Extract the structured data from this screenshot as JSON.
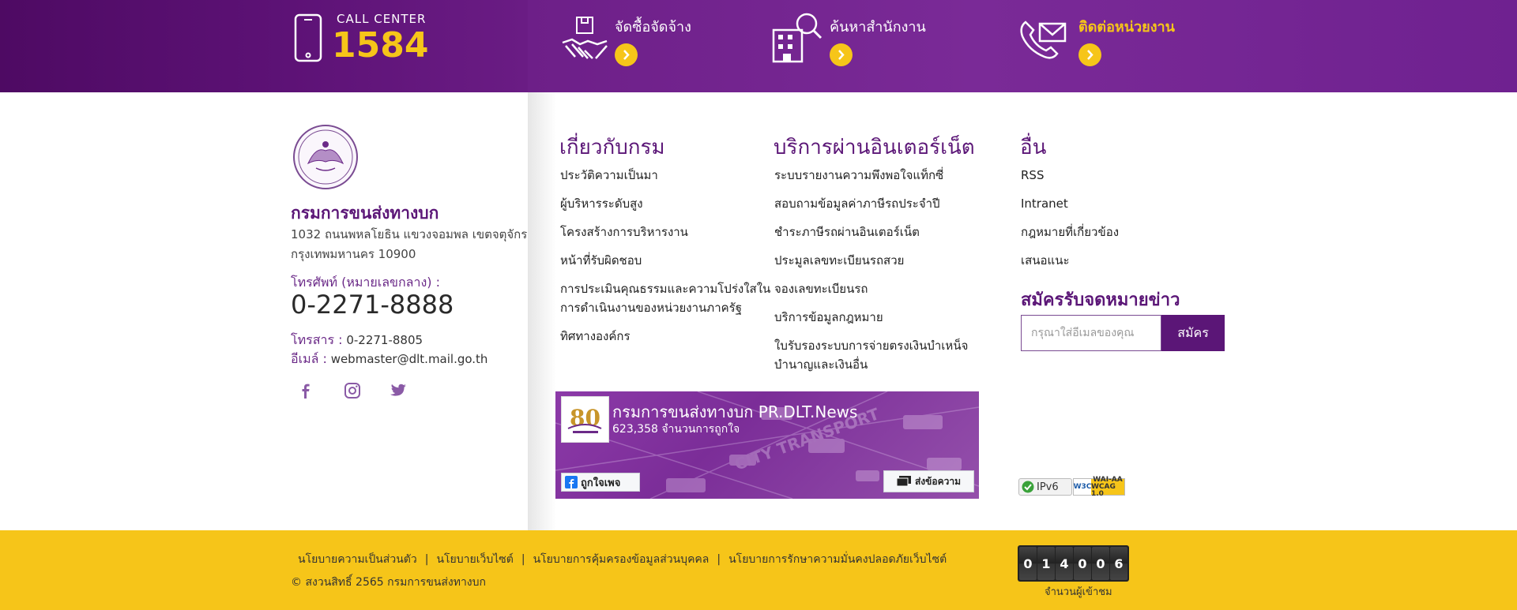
{
  "topbar": {
    "call_center_label": "CALL CENTER",
    "call_center_number": "1584",
    "quick_links": [
      {
        "label": "จัดซื้อจัดจ้าง",
        "icon": "handshake-icon"
      },
      {
        "label": "ค้นหาสำนักงาน",
        "icon": "building-search-icon"
      },
      {
        "label": "ติดต่อหน่วยงาน",
        "icon": "phone-envelope-icon"
      }
    ],
    "colors": {
      "dark_purple": "#4e0a63",
      "purple": "#7a2a97",
      "gold": "#f6c519"
    }
  },
  "org": {
    "name": "กรมการขนส่งทางบก",
    "address_line1": "1032 ถนนพหลโยธิน แขวงจอมพล เขตจตุจักร",
    "address_line2": "กรุงเทพมหานคร 10900",
    "tel_label": "โทรศัพท์ (หมายเลขกลาง) :",
    "tel_number": "0-2271-8888",
    "fax_label": "โทรสาร :",
    "fax_number": "0-2271-8805",
    "email_label": "อีเมล์ :",
    "email": "webmaster@dlt.mail.go.th",
    "social_icons": [
      "facebook-icon",
      "instagram-icon",
      "twitter-icon"
    ]
  },
  "columns": {
    "about": {
      "title": "เกี่ยวกับกรม",
      "items": [
        "ประวัติความเป็นมา",
        "ผู้บริหารระดับสูง",
        "โครงสร้างการบริหารงาน",
        "หน้าที่รับผิดชอบ",
        "การประเมินคุณธรรมและความโปร่งใสใน",
        "ทิศทางองค์กร"
      ],
      "item5_line2": "การดำเนินงานของหน่วยงานภาครัฐ"
    },
    "online": {
      "title": "บริการผ่านอินเตอร์เน็ต",
      "items": [
        "ระบบรายงานความพึงพอใจแท็กซี่",
        "สอบถามข้อมูลค่าภาษีรถประจำปี",
        "ชำระภาษีรถผ่านอินเตอร์เน็ต",
        "ประมูลเลขทะเบียนรถสวย",
        "จองเลขทะเบียนรถ",
        "บริการข้อมูลกฎหมาย",
        "ใบรับรองระบบการจ่ายตรงเงินบำเหน็จ"
      ],
      "item7_line2": "บำนาญและเงินอื่น"
    },
    "other": {
      "title": "อื่น",
      "items": [
        "RSS",
        "Intranet",
        "กฎหมายที่เกี่ยวข้อง",
        "เสนอแนะ"
      ]
    }
  },
  "newsletter": {
    "title": "สมัครรับจดหมายข่าว",
    "placeholder": "กรุณาใส่อีเมลของคุณ",
    "button": "สมัคร"
  },
  "facebook_widget": {
    "page_name": "กรมการขนส่งทางบก PR.DLT.News",
    "likes": "623,358 จำนวนการถูกใจ",
    "like_button": "ถูกใจเพจ",
    "message_button": "ส่งข้อความ",
    "background_text": "CITY TRANSPORT"
  },
  "badges": {
    "ipv6": "IPv6",
    "w3c": "W3C",
    "wai_line1": "WAI-AA",
    "wai_line2": "WCAG 1.0"
  },
  "footer": {
    "links": [
      "นโยบายความเป็นส่วนตัว",
      "นโยบายเว็บไซต์",
      "นโยบายการคุ้มครองข้อมูลส่วนบุคคล",
      "นโยบายการรักษาความมั่นคงปลอดภัยเว็บไซต์"
    ],
    "copyright": "© สงวนสิทธิ์ 2565 กรมการขนส่งทางบก",
    "counter_digits": [
      "0",
      "1",
      "4",
      "0",
      "0",
      "6"
    ],
    "counter_label": "จำนวนผู้เข้าชม"
  }
}
